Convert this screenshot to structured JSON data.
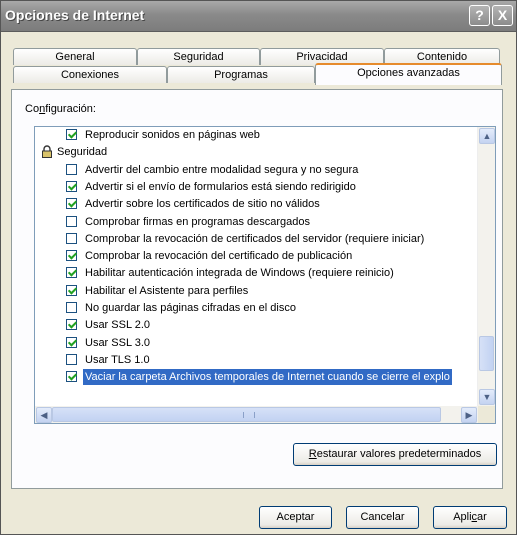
{
  "window": {
    "title": "Opciones de Internet",
    "help_symbol": "?",
    "close_symbol": "X"
  },
  "tabs": {
    "row_back": [
      "General",
      "Seguridad",
      "Privacidad",
      "Contenido"
    ],
    "row_front": [
      "Conexiones",
      "Programas",
      "Opciones avanzadas"
    ],
    "active": "Opciones avanzadas"
  },
  "settings": {
    "label_prefix": "Co",
    "label_accel": "n",
    "label_suffix": "figuración:",
    "items": [
      {
        "type": "checkbox",
        "checked": true,
        "text": "Reproducir sonidos en páginas web"
      },
      {
        "type": "group",
        "icon": "lock-icon",
        "text": "Seguridad"
      },
      {
        "type": "checkbox",
        "checked": false,
        "text": "Advertir del cambio entre modalidad segura y no segura"
      },
      {
        "type": "checkbox",
        "checked": true,
        "text": "Advertir si el envío de formularios está siendo redirigido"
      },
      {
        "type": "checkbox",
        "checked": true,
        "text": "Advertir sobre los certificados de sitio no válidos"
      },
      {
        "type": "checkbox",
        "checked": false,
        "text": "Comprobar firmas en programas descargados"
      },
      {
        "type": "checkbox",
        "checked": false,
        "text": "Comprobar la revocación de certificados del servidor (requiere iniciar)"
      },
      {
        "type": "checkbox",
        "checked": true,
        "text": "Comprobar la revocación del certificado de publicación"
      },
      {
        "type": "checkbox",
        "checked": true,
        "text": "Habilitar autenticación integrada de Windows (requiere reinicio)"
      },
      {
        "type": "checkbox",
        "checked": true,
        "text": "Habilitar el Asistente para perfiles"
      },
      {
        "type": "checkbox",
        "checked": false,
        "text": "No guardar las páginas cifradas en el disco"
      },
      {
        "type": "checkbox",
        "checked": true,
        "text": "Usar SSL 2.0"
      },
      {
        "type": "checkbox",
        "checked": true,
        "text": "Usar SSL 3.0"
      },
      {
        "type": "checkbox",
        "checked": false,
        "text": "Usar TLS 1.0"
      },
      {
        "type": "checkbox",
        "checked": true,
        "selected": true,
        "text": "Vaciar la carpeta Archivos temporales de Internet cuando se cierre el explo"
      }
    ]
  },
  "buttons": {
    "restore_accel": "R",
    "restore_rest": "estaurar valores predeterminados",
    "accept": "Aceptar",
    "cancel": "Cancelar",
    "apply_prefix": "Apli",
    "apply_accel": "c",
    "apply_suffix": "ar"
  },
  "colors": {
    "selection": "#316ac5",
    "check": "#21a121",
    "active_tab_accent": "#e68b2c"
  }
}
